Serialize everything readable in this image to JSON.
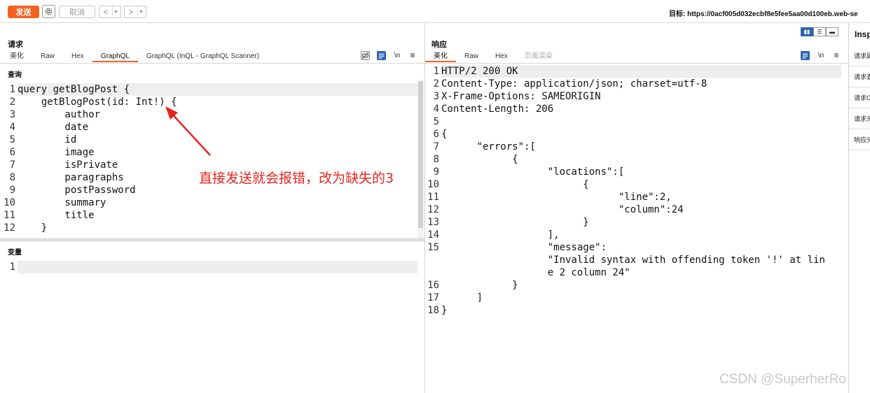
{
  "toolbar": {
    "send_label": "发送",
    "cancel_label": "取消",
    "back_label": "<",
    "forward_label": ">",
    "target_label": "目标: https://0acf005d032ecbf8e5fee5aa00d100eb.web-se"
  },
  "request": {
    "title": "请求",
    "tabs": [
      "美化",
      "Raw",
      "Hex",
      "GraphQL",
      "GraphQL (InQL - GraphQL Scanner)"
    ],
    "active_tab": "GraphQL",
    "query_label": "查询",
    "variables_label": "变量",
    "newline_label": "\\n",
    "query_lines": [
      {
        "n": "1",
        "t": "query getBlogPost {"
      },
      {
        "n": "2",
        "t": "    getBlogPost(id: Int!) {"
      },
      {
        "n": "3",
        "t": "        author"
      },
      {
        "n": "4",
        "t": "        date"
      },
      {
        "n": "5",
        "t": "        id"
      },
      {
        "n": "6",
        "t": "        image"
      },
      {
        "n": "7",
        "t": "        isPrivate"
      },
      {
        "n": "8",
        "t": "        paragraphs"
      },
      {
        "n": "9",
        "t": "        postPassword"
      },
      {
        "n": "10",
        "t": "        summary"
      },
      {
        "n": "11",
        "t": "        title"
      },
      {
        "n": "12",
        "t": "    }"
      }
    ],
    "variables_lines": [
      {
        "n": "1",
        "t": ""
      }
    ]
  },
  "annotation": "直接发送就会报错，改为缺失的3",
  "response": {
    "title": "响应",
    "tabs": [
      "美化",
      "Raw",
      "Hex",
      "页面渲染"
    ],
    "active_tab": "美化",
    "newline_label": "\\n",
    "lines": [
      {
        "n": "1",
        "t": "HTTP/2 200 OK"
      },
      {
        "n": "2",
        "t": "Content-Type: application/json; charset=utf-8"
      },
      {
        "n": "3",
        "t": "X-Frame-Options: SAMEORIGIN"
      },
      {
        "n": "4",
        "t": "Content-Length: 206"
      },
      {
        "n": "5",
        "t": ""
      },
      {
        "n": "6",
        "t": "{"
      },
      {
        "n": "7",
        "t": "      \"errors\":["
      },
      {
        "n": "8",
        "t": "            {"
      },
      {
        "n": "9",
        "t": "                  \"locations\":["
      },
      {
        "n": "10",
        "t": "                        {"
      },
      {
        "n": "11",
        "t": "                              \"line\":2,"
      },
      {
        "n": "12",
        "t": "                              \"column\":24"
      },
      {
        "n": "13",
        "t": "                        }"
      },
      {
        "n": "14",
        "t": "                  ],"
      },
      {
        "n": "15",
        "t": "                  \"message\":"
      },
      {
        "n": "",
        "t": "                  \"Invalid syntax with offending token '!' at lin"
      },
      {
        "n": "",
        "t": "                  e 2 column 24\""
      },
      {
        "n": "16",
        "t": "            }"
      },
      {
        "n": "17",
        "t": "      ]"
      },
      {
        "n": "18",
        "t": "}"
      }
    ]
  },
  "inspector": {
    "title": "Insp",
    "items": [
      "请求属性",
      "请求查询参数",
      "请求Cookie",
      "请求头",
      "响应头"
    ]
  },
  "watermark": "CSDN @SuperherRo"
}
